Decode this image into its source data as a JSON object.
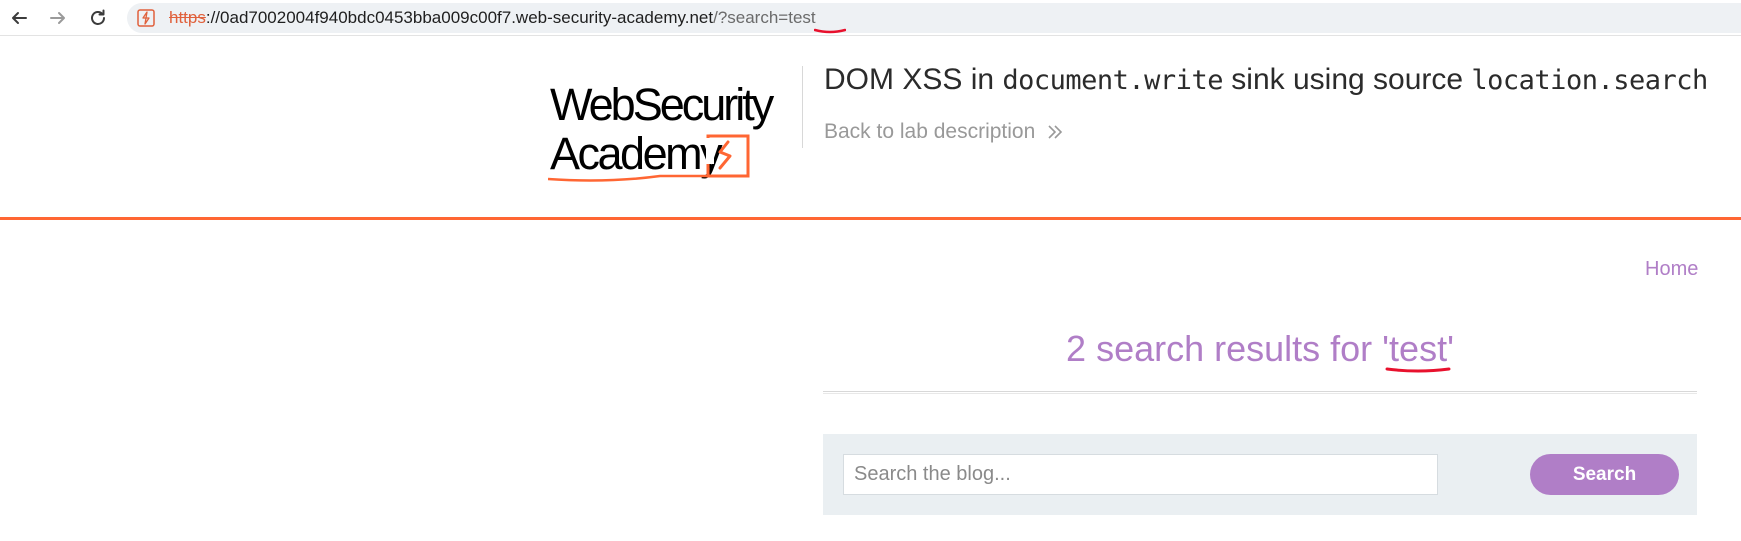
{
  "browser": {
    "url_scheme": "https",
    "url_host": "://0ad7002004f940bdc0453bba009c00f7.web-security-academy.net",
    "url_path": "/?search=test",
    "icons": [
      "back-arrow-icon",
      "forward-arrow-icon",
      "reload-icon",
      "site-lightning-icon"
    ]
  },
  "lab": {
    "logo_line1": "WebSecurity",
    "logo_line2": "Academy",
    "title_prefix": "DOM XSS in ",
    "title_code1": "document.write",
    "title_middle": " sink using source ",
    "title_code2": "location.search",
    "back_link": "Back to lab description",
    "accent_color": "#ff6633"
  },
  "nav": {
    "home": "Home"
  },
  "results": {
    "heading_prefix": "2 search results for '",
    "term": "test",
    "heading_suffix": "'",
    "color": "#b07ec7"
  },
  "search": {
    "placeholder": "Search the blog...",
    "button_label": "Search"
  },
  "annotation": {
    "underline_color": "#e8112d"
  }
}
